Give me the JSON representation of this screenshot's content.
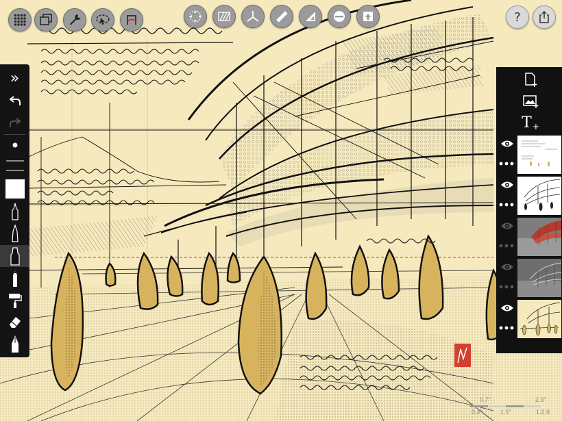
{
  "app": {
    "toolbar_left": [
      "grid-icon",
      "layers-stack-icon",
      "wrench-icon",
      "selection-lasso-icon",
      "perspective-guide-icon"
    ],
    "toolbar_center": [
      "transform-icon",
      "hatch-pattern-icon",
      "axis-guide-icon",
      "ruler-icon",
      "triangle-guide-icon",
      "ellipse-guide-icon",
      "shape-icon"
    ],
    "help_label": "?",
    "share_icon": "share-icon"
  },
  "left_tools": [
    {
      "name": "collapse-toolbar-icon",
      "glyph": "»"
    },
    {
      "name": "undo-icon"
    },
    {
      "name": "redo-icon"
    },
    {
      "name": "brush-size-dot"
    },
    {
      "name": "brush-opacity-lines"
    },
    {
      "name": "color-swatch",
      "color": "#ffffff"
    },
    {
      "name": "technical-pen-icon"
    },
    {
      "name": "fine-pen-icon"
    },
    {
      "name": "marker-icon",
      "selected": true
    },
    {
      "name": "pencil-icon"
    },
    {
      "name": "paint-roller-icon"
    },
    {
      "name": "eraser-icon"
    },
    {
      "name": "ink-nib-icon"
    }
  ],
  "right_panel": {
    "buttons": [
      "new-layer-icon",
      "image-layer-icon",
      "text-layer-icon"
    ],
    "text_glyph": "T",
    "layers": [
      {
        "visible": true,
        "thumbnail": "notes-layer"
      },
      {
        "visible": true,
        "thumbnail": "line-sketch-layer"
      },
      {
        "visible": false,
        "thumbnail": "red-gray-render-layer"
      },
      {
        "visible": false,
        "thumbnail": "gray-render-layer"
      },
      {
        "visible": true,
        "thumbnail": "color-sketch-layer"
      }
    ]
  },
  "scale_bar": {
    "top_left": "0.7\"",
    "top_right": "2.9\"",
    "bottom_left": "0.4\"",
    "bottom_mid": "1.5\"",
    "bottom_right": "1:2.9"
  },
  "colors": {
    "paper": "#f6e9bd",
    "ochre": "#d8b35e",
    "ink": "#111111",
    "toolbar_button": "#9b9b9b",
    "panel": "#111111",
    "signature_red": "#d2402f"
  }
}
